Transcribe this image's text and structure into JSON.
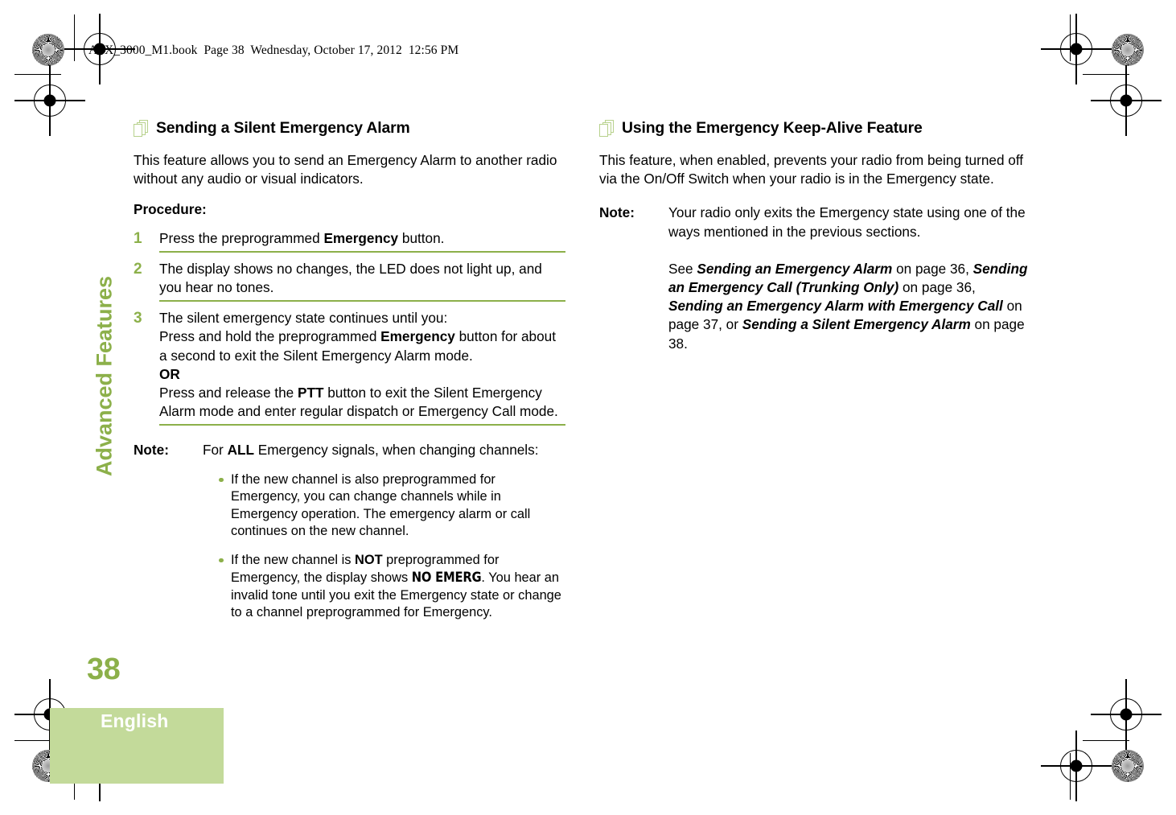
{
  "header": {
    "slug": "APX_3000_M1.book  Page 38  Wednesday, October 17, 2012  12:56 PM"
  },
  "chapter_tab": {
    "label": "Advanced Features"
  },
  "footer": {
    "page_number": "38",
    "language": "English"
  },
  "colors": {
    "accent_green": "#8CB04A",
    "band_green": "#C3DA9A",
    "icon_green": "#B7D18C"
  },
  "icons": {
    "section": "stacked-pages-icon"
  },
  "left_column": {
    "heading": "Sending a Silent Emergency Alarm",
    "intro": "This feature allows you to send an Emergency Alarm to another radio without any audio or visual indicators.",
    "procedure_label": "Procedure:",
    "steps": [
      {
        "number": "1",
        "segments": [
          {
            "text": "Press the preprogrammed ",
            "style": "normal"
          },
          {
            "text": "Emergency",
            "style": "bold"
          },
          {
            "text": " button.",
            "style": "normal"
          }
        ]
      },
      {
        "number": "2",
        "segments": [
          {
            "text": "The display shows no changes, the LED does not light up, and you hear no tones.",
            "style": "normal"
          }
        ]
      },
      {
        "number": "3",
        "segments": [
          {
            "text": "The silent emergency state continues until you:",
            "style": "normal"
          },
          {
            "text": "BREAK",
            "style": "break"
          },
          {
            "text": "Press and hold the preprogrammed ",
            "style": "normal"
          },
          {
            "text": "Emergency",
            "style": "bold"
          },
          {
            "text": " button for about a second to exit the Silent Emergency Alarm mode.",
            "style": "normal"
          },
          {
            "text": "BREAK",
            "style": "break"
          },
          {
            "text": "OR",
            "style": "bold"
          },
          {
            "text": "BREAK",
            "style": "break"
          },
          {
            "text": "Press and release the ",
            "style": "normal"
          },
          {
            "text": "PTT",
            "style": "bold"
          },
          {
            "text": " button to exit the Silent Emergency Alarm mode and enter regular dispatch or Emergency Call mode.",
            "style": "normal"
          }
        ]
      }
    ],
    "note": {
      "label": "Note:",
      "lead_segments": [
        {
          "text": "For ",
          "style": "normal"
        },
        {
          "text": "ALL",
          "style": "bold"
        },
        {
          "text": " Emergency signals, when changing channels:",
          "style": "normal"
        }
      ],
      "bullets": [
        {
          "segments": [
            {
              "text": "If the new channel is also preprogrammed for Emergency, you can change channels while in Emergency operation. The emergency alarm or call continues on the new channel.",
              "style": "normal"
            }
          ]
        },
        {
          "segments": [
            {
              "text": "If the new channel is ",
              "style": "normal"
            },
            {
              "text": "NOT",
              "style": "bold"
            },
            {
              "text": " preprogrammed for Emergency, the display shows ",
              "style": "normal"
            },
            {
              "text": "NO EMERG",
              "style": "lcd"
            },
            {
              "text": ". You hear an invalid tone until you exit the Emergency state or change to a channel preprogrammed for Emergency.",
              "style": "normal"
            }
          ]
        }
      ]
    }
  },
  "right_column": {
    "heading": "Using the Emergency Keep-Alive Feature",
    "intro": "This feature, when enabled, prevents your radio from being turned off via the On/Off Switch when your radio is in the Emergency state.",
    "note": {
      "label": "Note:",
      "lead_segments": [
        {
          "text": "Your radio only exits the Emergency state using one of the ways mentioned in the previous sections.",
          "style": "normal"
        },
        {
          "text": "PARA",
          "style": "para"
        },
        {
          "text": "See ",
          "style": "normal"
        },
        {
          "text": "Sending an Emergency Alarm",
          "style": "xref"
        },
        {
          "text": " on page 36, ",
          "style": "normal"
        },
        {
          "text": "Sending an Emergency Call (Trunking Only)",
          "style": "xref"
        },
        {
          "text": " on page 36, ",
          "style": "normal"
        },
        {
          "text": "Sending an Emergency Alarm with Emergency Call",
          "style": "xref"
        },
        {
          "text": " on page 37, or ",
          "style": "normal"
        },
        {
          "text": "Sending a Silent Emergency Alarm",
          "style": "xref"
        },
        {
          "text": " on page 38.",
          "style": "normal"
        }
      ]
    }
  }
}
